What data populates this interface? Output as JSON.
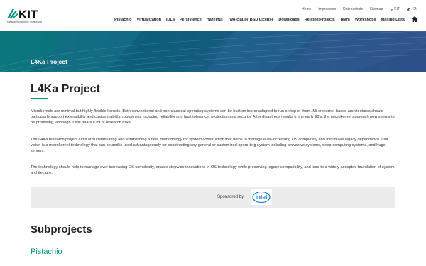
{
  "header": {
    "logo_text": "KIT",
    "logo_tagline": "Karlsruher Institut für Technologie",
    "utility_links": [
      "Home",
      "Impressum",
      "Datenschutz",
      "Sitemap",
      "KIT"
    ],
    "language": "EN",
    "nav_items": [
      "Pistachio",
      "Virtualization",
      "IDL4",
      "Persistence",
      "Hazelnut",
      "Two-clause BSD License",
      "Downloads",
      "Related Projects",
      "Team",
      "Workshops",
      "Mailing Lists"
    ]
  },
  "banner": {
    "title": "L4Ka Project"
  },
  "main": {
    "title": "L4Ka Project",
    "paragraphs": [
      "Microkernels are minimal but highly flexible kernels. Both conventional and non-classical operating systems can be built on top or adapted to run on top of them. Mi-crokernel-based architectures should particularly support extensibility and customizability, robustness including reliability and fault tolerance, protection and security. After disastrous results in the early 90's, the microkernel approach now seems to be promising, although it still bears a lot of research risks.",
      "The L4Ka research project aims at substantiating and establishing a new methodology for system construction that helps to manage ever-increasing OS complexity and minimizes legacy dependence. Our vision is a microkernel technology that can be and is used advantageously for constructing any general or customized opera-ting system including pervasive systems, deep-computing systems, and huge servers.",
      "The technology should help to manage ever-increasing OS complexity, enable stepwise innovations in OS technology while preserving legacy compatibility, and lead to a widely-accepted foundation of system architecture."
    ],
    "sponsor_label": "Sponsored by",
    "sponsor_logo": "intel",
    "subprojects_heading": "Subprojects",
    "first_subproject": "Pistachio"
  },
  "colors": {
    "accent": "#009682",
    "banner_start": "#0d6e78",
    "banner_end": "#2f4f8a"
  }
}
